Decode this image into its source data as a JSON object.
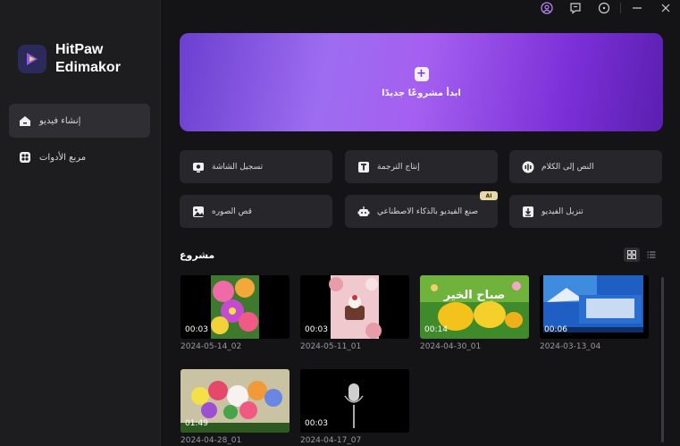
{
  "app": {
    "brand_line1": "HitPaw",
    "brand_line2": "Edimakor"
  },
  "sidebar": {
    "items": [
      {
        "label": "إنشاء فيديو",
        "icon": "home-icon",
        "active": true
      },
      {
        "label": "مربع الأدوات",
        "icon": "toolbox-icon",
        "active": false
      }
    ]
  },
  "titlebar": {
    "icons": [
      "account-icon",
      "feedback-icon",
      "info-icon",
      "minimize-icon",
      "close-icon"
    ]
  },
  "hero": {
    "label": "ابدأ مشروعًا جديدًا",
    "plus": "+"
  },
  "tools": [
    {
      "label": "تسجيل الشاشة",
      "icon": "screen-record-icon"
    },
    {
      "label": "إنتاج الترجمة",
      "icon": "subtitle-icon"
    },
    {
      "label": "النص إلى الكلام",
      "icon": "text-to-speech-icon"
    },
    {
      "label": "قص الصوره",
      "icon": "image-crop-icon"
    },
    {
      "label": "صنع الفيديو بالذكاء الاصطناعي",
      "icon": "ai-video-icon",
      "badge": "AI"
    },
    {
      "label": "تنزيل الفيديو",
      "icon": "download-icon"
    }
  ],
  "projects": {
    "title": "مشروع",
    "items": [
      {
        "name": "2024-05-14_02",
        "duration": "00:03",
        "thumb": "flowers"
      },
      {
        "name": "2024-05-11_01",
        "duration": "00:03",
        "thumb": "cake"
      },
      {
        "name": "2024-04-30_01",
        "duration": "00:14",
        "thumb": "tulips"
      },
      {
        "name": "2024-03-13_04",
        "duration": "00:06",
        "thumb": "blue"
      },
      {
        "name": "2024-04-28_01",
        "duration": "01:49",
        "thumb": "bouquet"
      },
      {
        "name": "2024-04-17_07",
        "duration": "00:03",
        "thumb": "mic"
      }
    ]
  },
  "colors": {
    "accent": "#9d6df0",
    "background": "#141416",
    "sidebar": "#1d1d20"
  }
}
